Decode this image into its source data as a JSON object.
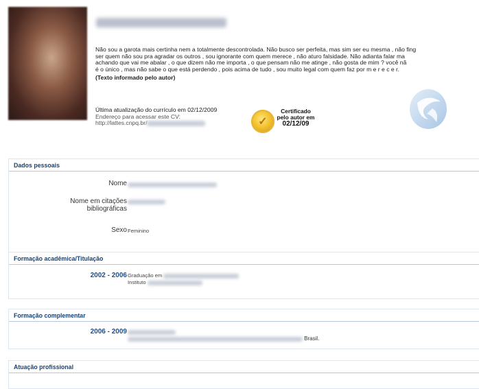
{
  "profile": {
    "bio_lines": [
      "Não sou a garota mais certinha nem a totalmente descontrolada. Não busco ser perfeita, mas sim ser eu mesma , não fing",
      "ser quem não sou pra agradar os outros , sou ignorante com quem merece , não aturo falsidade. Não adianta falar ma",
      "achando que vai me abalar , o que dizem não me importa , o que pensam não me atinge , não gosta de mim ? você nã",
      "é o único , mas não sabe o que está perdendo , pois acima de tudo , sou muito legal com quem faz por m e r e c e r."
    ],
    "author_note": "(Texto informado pelo autor)",
    "last_update": "Última atualização do currículo em 02/12/2009",
    "address_label": "Endereço para acessar este CV:",
    "address_url": "http://lattes.cnpq.br/",
    "certified_line1": "Certificado",
    "certified_line2": "pelo autor em",
    "certified_date": "02/12/09"
  },
  "sections": {
    "dados": {
      "title": "Dados pessoais",
      "nome_label": "Nome",
      "citacoes_label_1": "Nome em citações",
      "citacoes_label_2": "bibliográficas",
      "citacoes_value": "FERREIRA, T. S.",
      "sexo_label": "Sexo",
      "sexo_value": "Feminino"
    },
    "formacao": {
      "title": "Formação acadêmica/Titulação",
      "period": "2002 - 2006",
      "line1": "Graduação em",
      "line2": "Instituto"
    },
    "complementar": {
      "title": "Formação complementar",
      "period": "2006 - 2009",
      "suffix": "Brasil."
    },
    "atuacao": {
      "title": "Atuação profissional"
    }
  },
  "colors": {
    "section_title": "#14427a",
    "year": "#1d4f8a",
    "border": "#b6c7dd"
  },
  "icons": {
    "seal": "seal-icon",
    "logo": "cnpq-logo-icon"
  }
}
